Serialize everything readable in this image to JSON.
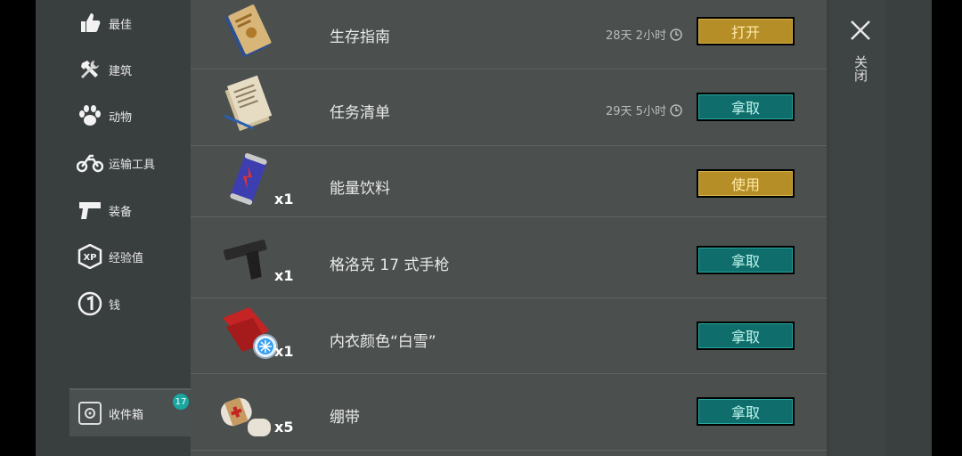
{
  "sidebar": {
    "items": [
      {
        "label": "最佳",
        "icon": "thumbs-up-icon"
      },
      {
        "label": "建筑",
        "icon": "hammer-wrench-icon"
      },
      {
        "label": "动物",
        "icon": "paw-icon"
      },
      {
        "label": "运输工具",
        "icon": "motorcycle-icon"
      },
      {
        "label": "装备",
        "icon": "pistol-icon"
      },
      {
        "label": "经验值",
        "icon": "xp-icon"
      },
      {
        "label": "钱",
        "icon": "coin-icon"
      }
    ],
    "inbox": {
      "label": "收件箱",
      "badge": "17"
    }
  },
  "rows": [
    {
      "name": "生存指南",
      "timer": "28天 2小时",
      "button": "打开",
      "style": "gold",
      "qty": "",
      "icon": "survival-guide-book-icon"
    },
    {
      "name": "任务清单",
      "timer": "29天 5小时",
      "button": "拿取",
      "style": "teal",
      "qty": "",
      "icon": "task-papers-icon"
    },
    {
      "name": "能量饮料",
      "timer": "",
      "button": "使用",
      "style": "gold",
      "qty": "x1",
      "icon": "energy-drink-can-icon"
    },
    {
      "name": "格洛克 17 式手枪",
      "timer": "",
      "button": "拿取",
      "style": "teal",
      "qty": "x1",
      "icon": "glock-pistol-icon"
    },
    {
      "name": "内衣颜色“白雪”",
      "timer": "",
      "button": "拿取",
      "style": "teal",
      "qty": "x1",
      "icon": "red-cloth-snowflake-icon"
    },
    {
      "name": "绷带",
      "timer": "",
      "button": "拿取",
      "style": "teal",
      "qty": "x5",
      "icon": "bandage-icon"
    }
  ],
  "close": {
    "label": "关闭"
  },
  "colors": {
    "gold_button": "#b58e28",
    "teal_button": "#0f6e6b",
    "badge": "#1aa7a0"
  }
}
